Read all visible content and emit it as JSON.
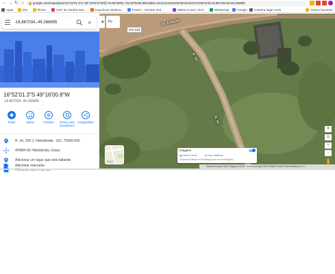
{
  "browser": {
    "url": "google.com/maps/place/16°52'01.3\"S+49°16'00.8\"W/@-16.8670902,-49.2670459,89m/data=!3m1!1e3!4m6!3m5!1s0:0x0!7e2!8m2!3d-16.867034!4d-49.266895",
    "bookmarks": [
      {
        "label": "Apps",
        "color": "#5f6368"
      },
      {
        "label": "site",
        "color": "#f4b400"
      },
      {
        "label": "filmes",
        "color": "#f4b400"
      },
      {
        "label": "CEP de Jardins Isla...",
        "color": "#db4437"
      },
      {
        "label": "Kaunhuxe Webma...",
        "color": "#e8710a"
      },
      {
        "label": "Painel :: Vendas Imó...",
        "color": "#4285f4"
      },
      {
        "label": "Minha Conta | OLX",
        "color": "#9334e6"
      },
      {
        "label": "WhatsApp",
        "color": "#0f9d58"
      },
      {
        "label": "Google",
        "color": "#4285f4"
      },
      {
        "label": "Carteira lugar certo",
        "color": "#5f6368"
      },
      {
        "label": "Outros favoritos",
        "color": "#f4b400"
      }
    ]
  },
  "search": {
    "value": "-16.867034,-49.266895"
  },
  "place": {
    "title": "16°52'01.3\"S 49°16'00.8\"W",
    "subtitle": "-16.867034,-49.266895"
  },
  "actions": [
    {
      "label": "Rotas",
      "icon": "directions-icon"
    },
    {
      "label": "Salvar",
      "icon": "bookmark-icon"
    },
    {
      "label": "Próximo",
      "icon": "nearby-icon"
    },
    {
      "label": "Enviar para smartphone",
      "icon": "send-to-phone-icon"
    },
    {
      "label": "Compartilhar",
      "icon": "share-icon"
    }
  ],
  "info": [
    {
      "text": "R. 34, 235-1, Hidrolândia - GO, 75340-000",
      "icon": "location-pin-icon"
    },
    {
      "text": "4PMM+56 Hidrolândia, Goiás",
      "icon": "plus-code-icon"
    },
    {
      "text": "Adicionar um lugar que está faltando",
      "icon": "add-place-icon"
    },
    {
      "text": "Adicionar sua empresa",
      "icon": "business-icon"
    },
    {
      "text": "Adicionar marcador",
      "icon": "label-icon"
    }
  ],
  "map": {
    "pegman_label": "Pv",
    "road_badge": "GO-319",
    "road_labels": [
      "Av. Epiqual",
      "R. 34",
      "R. 34"
    ],
    "layers_label": "Mapa",
    "imagery": {
      "title": "Imagens",
      "option_street_view": "Street View",
      "option_photo": "Foto esférica",
      "note": "Clique nas linhas em destaque para ver as imagens"
    },
    "zoom_in": "+",
    "zoom_out": "−",
    "footer": "Dados do mapa ©2021  Imagens ©2021 , Dados do mapa ©2021   Brasil   Termos   Enviar feedback   10 m"
  }
}
